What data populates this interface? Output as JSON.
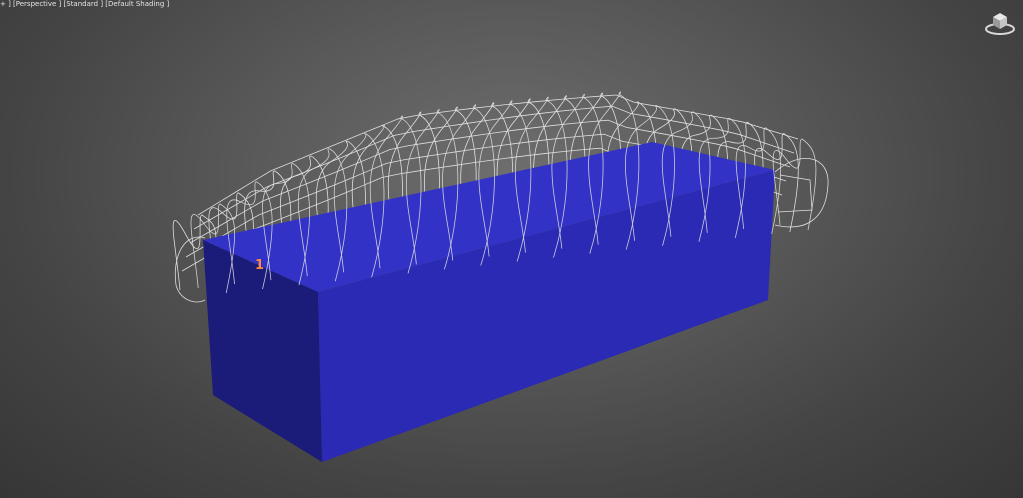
{
  "viewport": {
    "label_prefix": "+ ] ",
    "label_view": "[Perspective ]",
    "label_standard": "[Standard ]",
    "label_shading": "[Default Shading ]"
  },
  "scene": {
    "box_number": "1",
    "box_color_front": "#1b1b7a",
    "box_color_side": "#2a2ab4",
    "box_color_top": "#3232c6",
    "wire_color": "#e6e6e6",
    "background_center": "#6e6e6e",
    "background_edge": "#363636",
    "label_color": "#ff8a3c"
  },
  "icons": {
    "viewcube": "viewcube-icon"
  }
}
